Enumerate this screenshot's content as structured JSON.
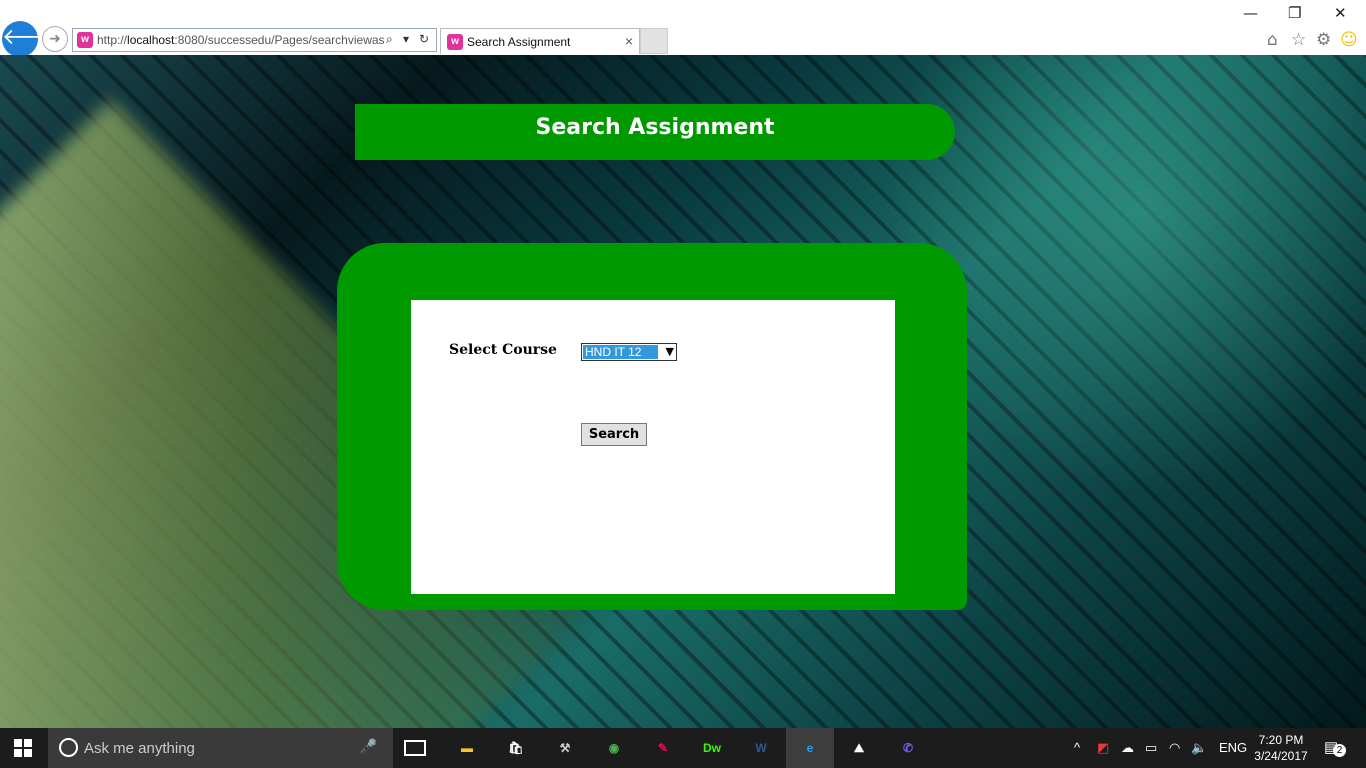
{
  "browser": {
    "url_prefix": "http://",
    "url_host": "localhost",
    "url_rest": ":8080/successedu/Pages/searchviewas",
    "tab_title": "Search Assignment",
    "tab_close": "×",
    "fav_glyph": "w",
    "back_glyph": "🡐",
    "forward_glyph": "➜",
    "search_glyph": "⌕",
    "dropdown_glyph": "▾",
    "refresh_glyph": "↻",
    "minimize_glyph": "—",
    "restore_glyph": "❐",
    "close_glyph": "✕",
    "home_glyph": "⌂",
    "star_glyph": "☆",
    "gear_glyph": "⚙",
    "smiley_glyph": "☺",
    "smiley_color": "#f2c200"
  },
  "page": {
    "title": "Search Assignment",
    "select_label": "Select Course",
    "course_selected": "HND IT 12",
    "select_arrow": "▼",
    "search_button": "Search",
    "accent": "#009900"
  },
  "taskbar": {
    "search_placeholder": "Ask me anything",
    "mic_glyph": "🎤",
    "apps": [
      {
        "name": "file-explorer",
        "glyph": "▬",
        "color": "#f4c430"
      },
      {
        "name": "store",
        "glyph": "🛍",
        "color": "#ffffff"
      },
      {
        "name": "tools",
        "glyph": "⚒",
        "color": "#ccc"
      },
      {
        "name": "chrome",
        "glyph": "◉",
        "color": "#4caf50"
      },
      {
        "name": "app",
        "glyph": "✎",
        "color": "#e05"
      },
      {
        "name": "dreamweaver",
        "glyph": "Dw",
        "color": "#35fa00"
      },
      {
        "name": "word",
        "glyph": "W",
        "color": "#2b5797"
      },
      {
        "name": "internet-explorer",
        "glyph": "e",
        "color": "#1ea1f2"
      },
      {
        "name": "photos",
        "glyph": "⛰",
        "color": "#ffffff"
      },
      {
        "name": "viber",
        "glyph": "✆",
        "color": "#7360f2"
      }
    ],
    "tray": {
      "chevron": "^",
      "lang": "ENG",
      "time": "7:20 PM",
      "date": "3/24/2017",
      "notifications": "2"
    }
  }
}
